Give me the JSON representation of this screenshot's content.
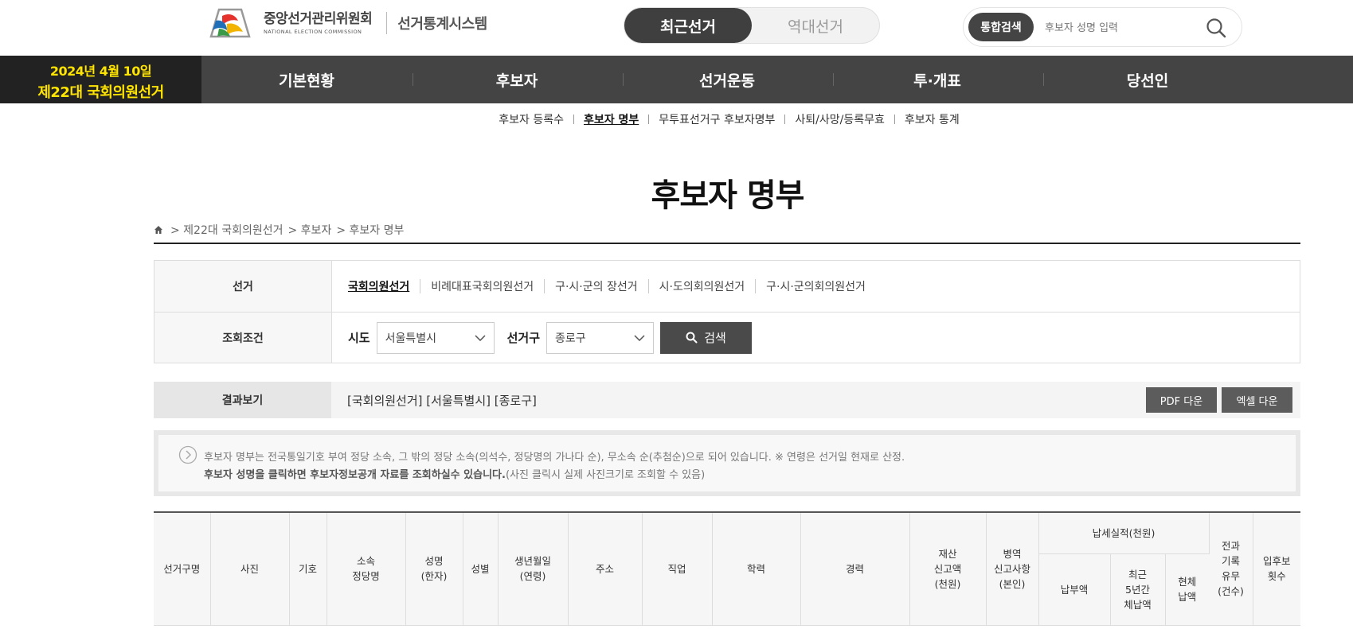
{
  "header": {
    "org_name_ko": "중앙선거관리위원회",
    "org_name_en": "NATIONAL ELECTION COMMISSION",
    "system_name": "선거통계시스템",
    "toggle": {
      "recent": "최근선거",
      "past": "역대선거"
    },
    "search": {
      "chip": "통합검색",
      "placeholder": "후보자 성명 입력"
    }
  },
  "election_badge": {
    "date": "2024년 4월 10일",
    "name": "제22대 국회의원선거"
  },
  "gnb": [
    "기본현황",
    "후보자",
    "선거운동",
    "투·개표",
    "당선인"
  ],
  "submenu": [
    "후보자 등록수",
    "후보자 명부",
    "무투표선거구 후보자명부",
    "사퇴/사망/등록무효",
    "후보자 통계"
  ],
  "page_title": "후보자 명부",
  "breadcrumb": [
    "> 제22대 국회의원선거",
    "> 후보자",
    "> 후보자 명부"
  ],
  "filter": {
    "election_label": "선거",
    "election_tabs": [
      "국회의원선거",
      "비례대표국회의원선거",
      "구·시·군의 장선거",
      "시·도의회의원선거",
      "구·시·군의회의원선거"
    ],
    "condition_label": "조회조건",
    "sido_label": "시도",
    "sido_value": "서울특별시",
    "district_label": "선거구",
    "district_value": "종로구",
    "search_button": "검색"
  },
  "result": {
    "label": "결과보기",
    "text": "[국회의원선거] [서울특별시] [종로구]",
    "pdf_button": "PDF 다운",
    "excel_button": "엑셀 다운"
  },
  "notice": {
    "line1": "후보자 명부는 전국통일기호 부여 정당 소속, 그 밖의 정당 소속(의석수, 정당명의 가나다 순), 무소속 순(추첨순)으로 되어 있습니다. ※ 연령은 선거일 현재로 산정.",
    "line2_bold": "후보자 성명을 클릭하면 후보자정보공개 자료를 조회하실수 있습니다.",
    "line2_rest": "(사진 클릭시 실제 사진크기로 조회할 수 있음)"
  },
  "table": {
    "headers": {
      "district": "선거구명",
      "photo": "사진",
      "number": "기호",
      "party": "소속\n정당명",
      "name": "성명\n(한자)",
      "gender": "성별",
      "birth": "생년월일\n(연령)",
      "address": "주소",
      "job": "직업",
      "education": "학력",
      "career": "경력",
      "assets": "재산\n신고액\n(천원)",
      "military": "병역\n신고사항\n(본인)",
      "tax_group": "납세실적(천원)",
      "tax_paid": "납부액",
      "tax_arrears_5y": "최근\n5년간\n체납액",
      "tax_arrears_now": "현체\n납액",
      "criminal": "전과\n기록\n유무\n(건수)",
      "runs": "입후보\n횟수"
    }
  },
  "colors": {
    "gnb": "#444444",
    "badge_bg": "#222222",
    "badge_text": "#ffe400"
  }
}
